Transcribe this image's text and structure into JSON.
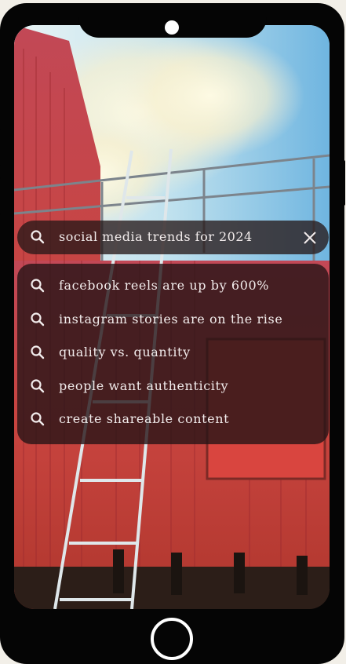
{
  "search": {
    "query": "social media trends for 2024",
    "icon": "search-icon",
    "clear_icon": "close-icon"
  },
  "suggestions": [
    {
      "label": "facebook reels are up  by 600%",
      "icon": "search-icon"
    },
    {
      "label": "instagram stories are on the rise",
      "icon": "search-icon"
    },
    {
      "label": "quality vs. quantity",
      "icon": "search-icon"
    },
    {
      "label": "people want authenticity",
      "icon": "search-icon"
    },
    {
      "label": "create shareable content",
      "icon": "search-icon"
    }
  ],
  "colors": {
    "phone_frame": "#050505",
    "panel": "#261618",
    "text": "#f2ecec"
  }
}
